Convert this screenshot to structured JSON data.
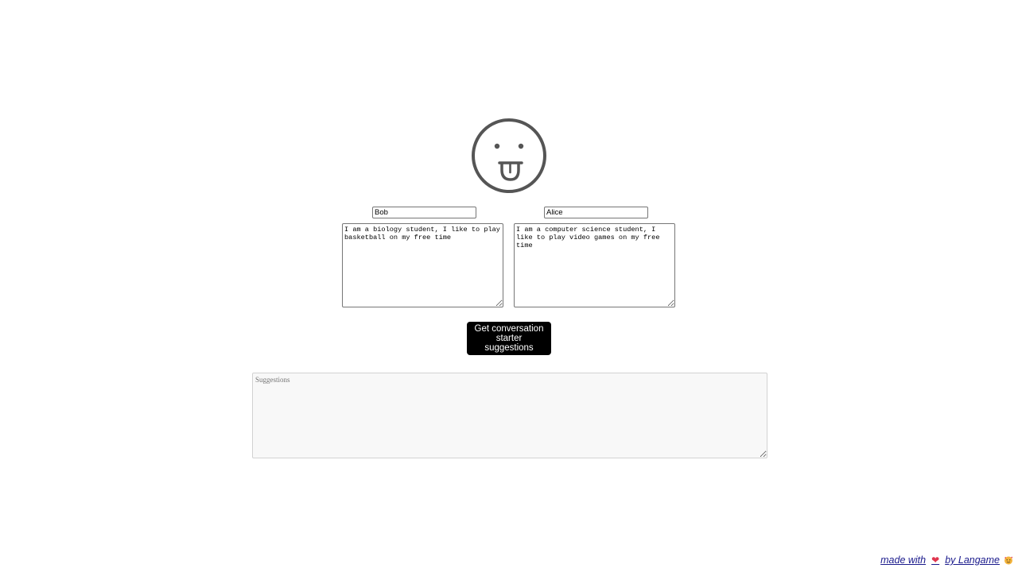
{
  "logo": {
    "icon": "tongue-out-face-icon",
    "stroke_color": "#555555"
  },
  "person_a": {
    "name": "Bob",
    "bio": "I am a biology student, I like to play basketball on my free time"
  },
  "person_b": {
    "name": "Alice",
    "bio": "I am a computer science student, I like to play video games on my free time"
  },
  "action": {
    "label_line1": "Get conversation",
    "label_line2": "starter suggestions",
    "background": "#000000"
  },
  "suggestions": {
    "placeholder": "Suggestions",
    "value": ""
  },
  "footer": {
    "made_with": "made with",
    "by_text": "by Langame",
    "heart_icon": "heart-icon",
    "emoji_icon": "face-with-hearts-icon",
    "link_color": "#1a1a8c"
  }
}
